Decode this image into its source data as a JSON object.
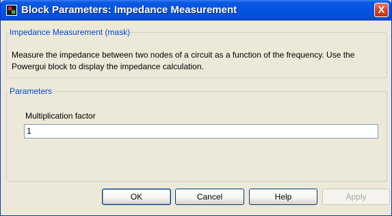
{
  "window": {
    "title": "Block Parameters: Impedance Measurement",
    "close_label": "X"
  },
  "mask": {
    "legend": "Impedance Measurement (mask)",
    "description": "Measure the impedance between two nodes of a circuit as a function of the frequency. Use the Powergui block to display the impedance calculation."
  },
  "parameters": {
    "legend": "Parameters",
    "multiplication_factor": {
      "label": "Multiplication factor",
      "value": "1"
    }
  },
  "buttons": {
    "ok": "OK",
    "cancel": "Cancel",
    "help": "Help",
    "apply": "Apply",
    "apply_enabled": false
  },
  "colors": {
    "titlebar": "#0554e3",
    "legend_text": "#0046d5",
    "dialog_bg": "#ece9d8",
    "close_button": "#d5431f"
  }
}
